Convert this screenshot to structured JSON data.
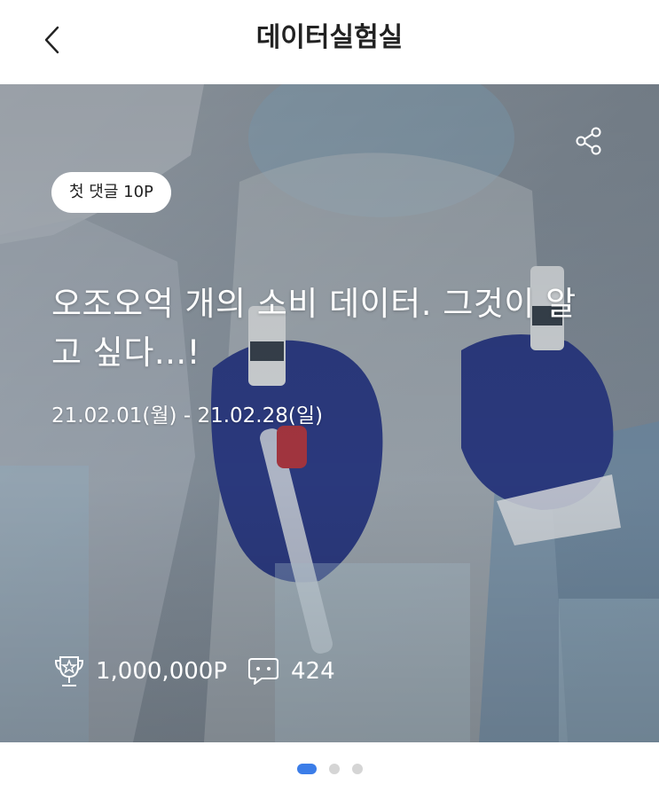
{
  "header": {
    "title": "데이터실험실"
  },
  "banner": {
    "badge": "첫 댓글 10P",
    "headline": "오조오억 개의 소비 데이터. 그것이 알고 싶다...!",
    "period": "21.02.01(월) - 21.02.28(일)",
    "reward": "1,000,000P",
    "comments": "424",
    "icons": [
      "share-icon",
      "trophy-icon",
      "comment-icon"
    ]
  },
  "pager": {
    "total": 3,
    "active": 1,
    "active_color": "#3b7de8"
  }
}
